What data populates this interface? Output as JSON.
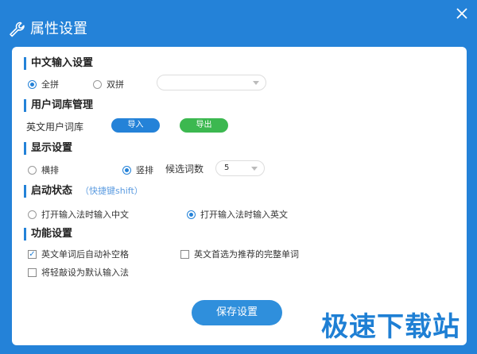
{
  "window": {
    "title": "属性设置"
  },
  "sections": {
    "chinese_input": {
      "title": "中文输入设置",
      "option_quanpin": "全拼",
      "option_shuangpin": "双拼",
      "shuangpin_select_value": "",
      "selected": "全拼"
    },
    "user_dict": {
      "title": "用户词库管理",
      "label": "英文用户词库",
      "import_label": "导入",
      "export_label": "导出",
      "import_color": "#2482d8",
      "export_color": "#3cb850"
    },
    "display": {
      "title": "显示设置",
      "option_horizontal": "横排",
      "option_vertical": "竖排",
      "selected": "竖排",
      "candidates_label": "候选词数",
      "candidates_value": "5"
    },
    "startup": {
      "title": "启动状态",
      "hint": "（快捷键shift）",
      "option_chinese": "打开输入法时输入中文",
      "option_english": "打开输入法时输入英文",
      "selected": "打开输入法时输入英文"
    },
    "features": {
      "title": "功能设置",
      "auto_space": {
        "label": "英文单词后自动补空格",
        "checked": true
      },
      "prefer_complete": {
        "label": "英文首选为推荐的完整单词",
        "checked": false
      },
      "set_default": {
        "label": "将轻敲设为默认输入法",
        "checked": false
      }
    }
  },
  "save_label": "保存设置",
  "watermark": "极速下载站",
  "colors": {
    "accent": "#2482d8",
    "green": "#3cb850",
    "background": "#2482d8"
  }
}
